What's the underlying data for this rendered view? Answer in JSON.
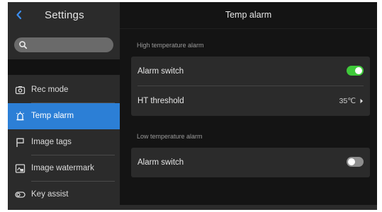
{
  "sidebar": {
    "title": "Settings",
    "search": {
      "placeholder": "",
      "value": ""
    },
    "items": [
      {
        "label": "Rec mode",
        "icon": "camera-icon",
        "active": false
      },
      {
        "label": "Temp alarm",
        "icon": "thermometer-alarm-icon",
        "active": true
      },
      {
        "label": "Image tags",
        "icon": "flag-icon",
        "active": false
      },
      {
        "label": "Image watermark",
        "icon": "watermark-icon",
        "active": false
      },
      {
        "label": "Key assist",
        "icon": "toggle-key-icon",
        "active": false
      }
    ]
  },
  "main": {
    "title": "Temp alarm",
    "sections": [
      {
        "label": "High temperature alarm",
        "rows": [
          {
            "label": "Alarm switch",
            "toggle": true
          },
          {
            "label": "HT threshold",
            "value": "35℃"
          }
        ]
      },
      {
        "label": "Low temperature alarm",
        "rows": [
          {
            "label": "Alarm switch",
            "toggle": false
          }
        ]
      }
    ]
  },
  "colors": {
    "accent": "#2c7fd6",
    "toggle_on": "#3fc93a",
    "toggle_off": "#8e8e8e",
    "background": "#141414",
    "panel": "#2b2b2b"
  }
}
